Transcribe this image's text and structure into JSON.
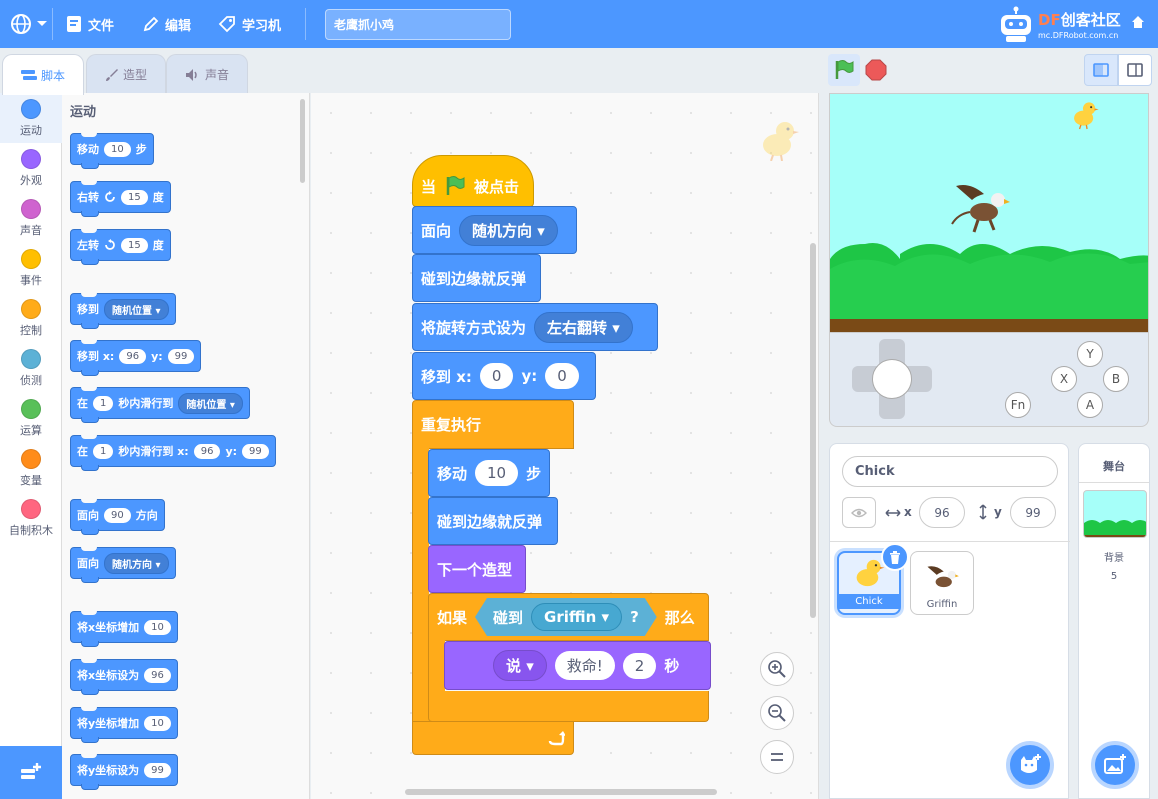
{
  "menu": {
    "file": "文件",
    "edit": "编辑",
    "learning_machine": "学习机",
    "project_title": "老鹰抓小鸡",
    "brand_cn": "创客社区",
    "brand_df": "DF",
    "brand_url": "mc.DFRobot.com.cn"
  },
  "tabs": {
    "code": "脚本",
    "costumes": "造型",
    "sounds": "声音"
  },
  "categories": [
    {
      "label": "运动",
      "color": "#4c97ff"
    },
    {
      "label": "外观",
      "color": "#9966ff"
    },
    {
      "label": "声音",
      "color": "#cf63cf"
    },
    {
      "label": "事件",
      "color": "#ffbf00"
    },
    {
      "label": "控制",
      "color": "#ffab19"
    },
    {
      "label": "侦测",
      "color": "#5cb1d6"
    },
    {
      "label": "运算",
      "color": "#59c059"
    },
    {
      "label": "变量",
      "color": "#ff8c1a"
    },
    {
      "label": "自制积木",
      "color": "#ff6680"
    }
  ],
  "palette": {
    "title": "运动",
    "move": {
      "label": "移动",
      "steps": "10",
      "unit": "步"
    },
    "turn_right": {
      "label": "右转",
      "deg": "15",
      "unit": "度"
    },
    "turn_left": {
      "label": "左转",
      "deg": "15",
      "unit": "度"
    },
    "goto": {
      "label": "移到",
      "target": "随机位置"
    },
    "goto_xy": {
      "label": "移到 x:",
      "x": "96",
      "ylabel": "y:",
      "y": "99"
    },
    "glide": {
      "pre": "在",
      "secs": "1",
      "mid": "秒内滑行到",
      "target": "随机位置"
    },
    "glide_xy": {
      "pre": "在",
      "secs": "1",
      "mid": "秒内滑行到 x:",
      "x": "96",
      "ylabel": "y:",
      "y": "99"
    },
    "point_dir": {
      "label": "面向",
      "dir": "90",
      "unit": "方向"
    },
    "point_towards": {
      "label": "面向",
      "target": "随机方向"
    },
    "change_x": {
      "label": "将x坐标增加",
      "val": "10"
    },
    "set_x": {
      "label": "将x坐标设为",
      "val": "96"
    },
    "change_y": {
      "label": "将y坐标增加",
      "val": "10"
    },
    "set_y": {
      "label": "将y坐标设为",
      "val": "99"
    }
  },
  "script": {
    "hat_when": "当",
    "hat_clicked": "被点击",
    "point_label": "面向",
    "point_target": "随机方向",
    "bounce": "碰到边缘就反弹",
    "rot_label": "将旋转方式设为",
    "rot_value": "左右翻转",
    "goto_label": "移到 x:",
    "goto_x": "0",
    "goto_ylabel": "y:",
    "goto_y": "0",
    "forever": "重复执行",
    "move_label": "移动",
    "move_steps": "10",
    "move_unit": "步",
    "bounce2": "碰到边缘就反弹",
    "next_costume": "下一个造型",
    "if_label": "如果",
    "touching": "碰到",
    "touch_target": "Griffin",
    "question": "?",
    "then": "那么",
    "say_label": "说",
    "say_text": "救命!",
    "say_secs": "2",
    "say_unit": "秒"
  },
  "sprite_info": {
    "name": "Chick",
    "x_label": "x",
    "x": "96",
    "y_label": "y",
    "y": "99"
  },
  "sprites": [
    {
      "name": "Chick"
    },
    {
      "name": "Griffin"
    }
  ],
  "gamepad": {
    "y": "Y",
    "x": "X",
    "b": "B",
    "a": "A",
    "fn": "Fn"
  },
  "stage_panel": {
    "title": "舞台",
    "backdrop_label": "背景",
    "backdrop_count": "5"
  }
}
